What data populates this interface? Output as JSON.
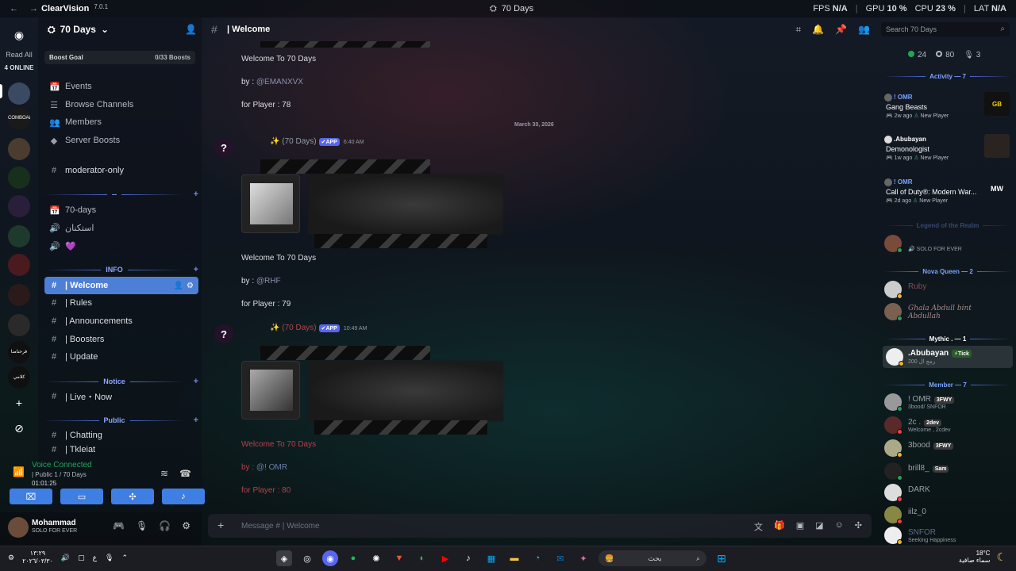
{
  "titlebar": {
    "app": "ClearVision",
    "version": "7.0.1",
    "server_title": "70 Days",
    "stats": [
      {
        "label": "FPS",
        "value": "N/A"
      },
      {
        "label": "GPU",
        "value": "10 %"
      },
      {
        "label": "CPU",
        "value": "23 %"
      },
      {
        "label": "LAT",
        "value": "N/A"
      }
    ]
  },
  "rail": {
    "read_all": "Read All",
    "online": "4 ONLINE",
    "server_texts": [
      "COMBOALOM",
      "فرحنامنا",
      "كلامي"
    ]
  },
  "sidebar": {
    "server_name": "70 Days",
    "boost_goal": "Boost Goal",
    "boost_count": "0/33 Boosts",
    "items": [
      {
        "icon": "📅",
        "label": "Events"
      },
      {
        "icon": "☰",
        "label": "Browse Channels"
      },
      {
        "icon": "👥",
        "label": "Members"
      },
      {
        "icon": "◆",
        "label": "Server Boosts"
      },
      {
        "icon": "#",
        "label": "moderator-only"
      },
      {
        "icon": "📅",
        "label": "70-days"
      },
      {
        "icon": "🔊",
        "label": "استكنان"
      },
      {
        "icon": "🔊",
        "label": "💜"
      },
      {
        "icon": "#",
        "label": "| Welcome"
      },
      {
        "icon": "#",
        "label": "| Rules"
      },
      {
        "icon": "#",
        "label": "| Announcements"
      },
      {
        "icon": "#",
        "label": "| Boosters"
      },
      {
        "icon": "#",
        "label": "| Update"
      },
      {
        "icon": "#",
        "label": "| Live・Now"
      },
      {
        "icon": "#",
        "label": "| Chatting"
      },
      {
        "icon": "#",
        "label": "| Tkleiat"
      }
    ],
    "categories": [
      "--",
      "INFO",
      "Notice",
      "Public"
    ]
  },
  "voice": {
    "status": "Voice Connected",
    "channel": "| Public 1 / 70 Days",
    "time": "01:01:25"
  },
  "user": {
    "name": "Mohammad",
    "status": "SOLO FOR EVER"
  },
  "chat": {
    "channel": "| Welcome",
    "search_placeholder": "Search 70 Days",
    "composer_placeholder": "Message #  | Welcome",
    "date": "March 30, 2026",
    "messages": [
      {
        "welcome": "Welcome To 70 Days",
        "by": "by :",
        "mention": "@EMANXVX",
        "player": "for Player : 78"
      },
      {
        "author": "(70 Days)",
        "badge": "✔APP",
        "time": "6:40 AM",
        "welcome": "Welcome To 70 Days",
        "by": "by :",
        "mention": "@RHF",
        "player": "for Player : 79"
      },
      {
        "author": "(70 Days)",
        "badge": "✔APP",
        "time": "10:49 AM",
        "welcome": "Welcome To 70 Days",
        "by": "by :",
        "mention": "@! OMR",
        "player": "for Player : 80"
      }
    ]
  },
  "members": {
    "online": "24",
    "offline": "80",
    "voice": "3",
    "activity_title": "Activity — 7",
    "activities": [
      {
        "user": "! OMR",
        "game": "Gang Beasts",
        "ago": "2w ago",
        "tag": "New Player"
      },
      {
        "user": ".Abubayan",
        "game": "Demonologist",
        "ago": "1w ago",
        "tag": "New Player"
      },
      {
        "user": "! OMR",
        "game": "Call of Duty®: Modern War...",
        "ago": "2d ago",
        "tag": "New Player"
      }
    ],
    "sections": [
      {
        "title": "Legend of the Realm",
        "members": [
          {
            "name": "",
            "sub": "SOLO FOR EVER"
          }
        ]
      },
      {
        "title": "Nova Queen — 2",
        "members": [
          {
            "name": "Ruby",
            "sub": ""
          },
          {
            "name": "Ghala Abdull bint Abdullah",
            "sub": ""
          }
        ]
      },
      {
        "title": "Mythic . — 1",
        "members": [
          {
            "name": ".Abubayan",
            "tag": "Tick",
            "sub": "رمج ال 200"
          }
        ]
      },
      {
        "title": "Member — 7",
        "members": [
          {
            "name": "! OMR",
            "tag": "3FWY",
            "sub": "3bood/ SNFOR"
          },
          {
            "name": "2c .",
            "tag": "2dev",
            "sub": "Welcome , 2cdev"
          },
          {
            "name": "3bood",
            "tag": "3FWY",
            "sub": ""
          },
          {
            "name": "brill8_",
            "tag": "Sam",
            "sub": ""
          },
          {
            "name": "DARK",
            "sub": ""
          },
          {
            "name": "iilz_0",
            "sub": ""
          },
          {
            "name": "SNFOR",
            "sub": "Seeking Happiness"
          }
        ]
      }
    ]
  },
  "taskbar": {
    "time": "١٣:٢٩",
    "date": "٢٠٢٦/٠٣/٣٠",
    "search": "بحث",
    "temp": "18°C",
    "weather": "سماء صافية"
  },
  "colors": {
    "accent": "#4e7fd6",
    "online": "#23a559",
    "blurple": "#5865f2"
  }
}
